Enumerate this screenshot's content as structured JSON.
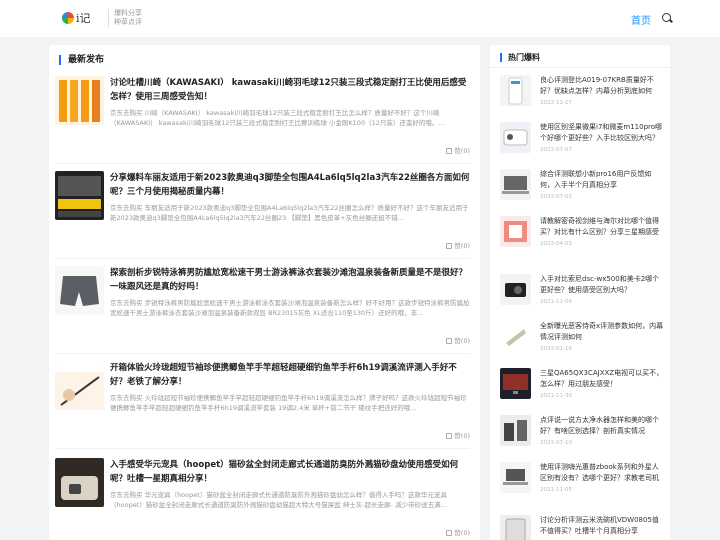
{
  "header": {
    "logo_text": "i记",
    "slogan_line1": "爆料分享",
    "slogan_line2": "种草点评",
    "nav_home": "首页"
  },
  "main": {
    "section_title": "最新发布",
    "posts": [
      {
        "title": "讨论吐槽川崎（KAWASAKI） kawasaki川崎羽毛球12只装三段式稳定耐打王比使用后感受怎样？使用三周感受告知！",
        "desc": "京东去购买 川崎（KAWASAKI） kawasaki川崎羽毛球12只装三段式稳定耐打王比怎么样？质量好不好？这个川崎（KAWASAKI） kawasaki川崎羽毛球12只装三段式稳定耐打王比赛训练球 小金刚K100（12只装）还蛮好的哦。...",
        "likes": "赞(0)"
      },
      {
        "title": "分享爆料车丽友适用于新2023款奥迪q3脚垫全包围A4La6lq5lq2la3汽车22丝圈各方面如何呢？三个月使用揭秘质量内幕！",
        "desc": "京东去购买 车丽友适用于新2023款奥迪q3脚垫全包围A4La6lq5lq2la3汽车22丝圈怎么样？质量好不好？这个车丽友适用于新2023款奥迪q3脚垫全包围A4La6lq5lq2la3汽车22丝圈23 【脚垫】黑色皮革+灰色丝圈还挺不错...",
        "likes": "赞(0)"
      },
      {
        "title": "探索剖析步锐特泳裤男防尴尬宽松速干男士游泳裤泳衣套装沙滩泡温泉装备新质量是不是很好？一味跟风还是真的好吗！",
        "desc": "京东去购买 步锐特泳裤男防尴尬宽松速干男士游泳裤泳衣套装沙滩泡温泉装备新怎么样？好不好用？这款步锐特泳裤男防尴尬宽松速干男士游泳裤泳衣套装沙滩泡温泉装备新款双层 BR23015灰色 XL适合110至130斤）还好的哦，非...",
        "likes": "赞(0)"
      },
      {
        "title": "开箱体验火玲珑超短节袖珍便携鲫鱼竿手竿超轻超硬细钓鱼竿手杆6h19调溪流评测入手好不好？老铁了解分享！",
        "desc": "京东去购买 火玲珑超短节袖珍便携鲫鱼竿手竿超轻超硬细钓鱼竿手杆6h19调溪流怎么样？牌子好吗？这款火玲珑超短节袖珍便携鲫鱼竿手竿超轻超硬细钓鱼竿手杆6h19调溪流竿套装 19调2.4米 单杆+前二节干 碟纹手把还好的哦...",
        "likes": "赞(0)"
      },
      {
        "title": "入手感受华元宠具（hoopet）猫砂盆全封闭走廊式长通道防臭防外溅猫砂盘幼使用感受如何呢？吐槽一星期真相分享！",
        "desc": "京东去购买 华元宠具（hoopet）猫砂盆全封闭走廊式长通道防臭防外溅猫砂盘幼怎么样？值得入手吗？这款华元宠具（hoopet）猫砂盆全封闭走廊式长通道防臭防外溅猫砂盘幼猫超大特大号猫屎盆 绅士灰-超长走廊- 减少带砂送五满...",
        "likes": "赞(0)"
      }
    ]
  },
  "sidebar": {
    "title": "热门爆料",
    "items": [
      {
        "title": "良心评测登比A019-07KRB质量好不好？优缺点怎样？内幕分析到底如何",
        "date": "2022-11-27"
      },
      {
        "title": "使用区别坚果微果i7和微麦m110pro哪个好哪个更好些？入手比较区别大吗？",
        "date": "2023-07-07"
      },
      {
        "title": "综合评测联想小新pro16用户反馈如何，入手半个月真相分享",
        "date": "2023-07-01"
      },
      {
        "title": "请教解密奇视剑维与海尔对比哪个值得买？对比有什么区别？分享三星期感受告知",
        "date": "2023-04-03"
      },
      {
        "title": "入手对比索尼dsc-wx500和美卡2哪个更好些？使用感受区别大吗？",
        "date": "2021-11-04"
      },
      {
        "title": "全新曝光恶客侍奇x评测参数如何，内幕情况评测如何",
        "date": "2023-01-16"
      },
      {
        "title": "三星QA65QX3CAJXXZ电视可以买不，怎么样？用过朋友感受！",
        "date": "2021-11-30"
      },
      {
        "title": "点评说一说方太净水器怎样和美的哪个好？有啥区别选择？剖析真实情况",
        "date": "2023-07-10"
      },
      {
        "title": "使用评测嗨光惠普zbook系列和外星人区别有没有？选哪个更好？求教老司机解答",
        "date": "2021-11-05"
      },
      {
        "title": "讨论分析评测云米洗碗机VDW0805值不值得买？吐槽半个月真相分享",
        "date": "2023-06-19"
      }
    ]
  }
}
